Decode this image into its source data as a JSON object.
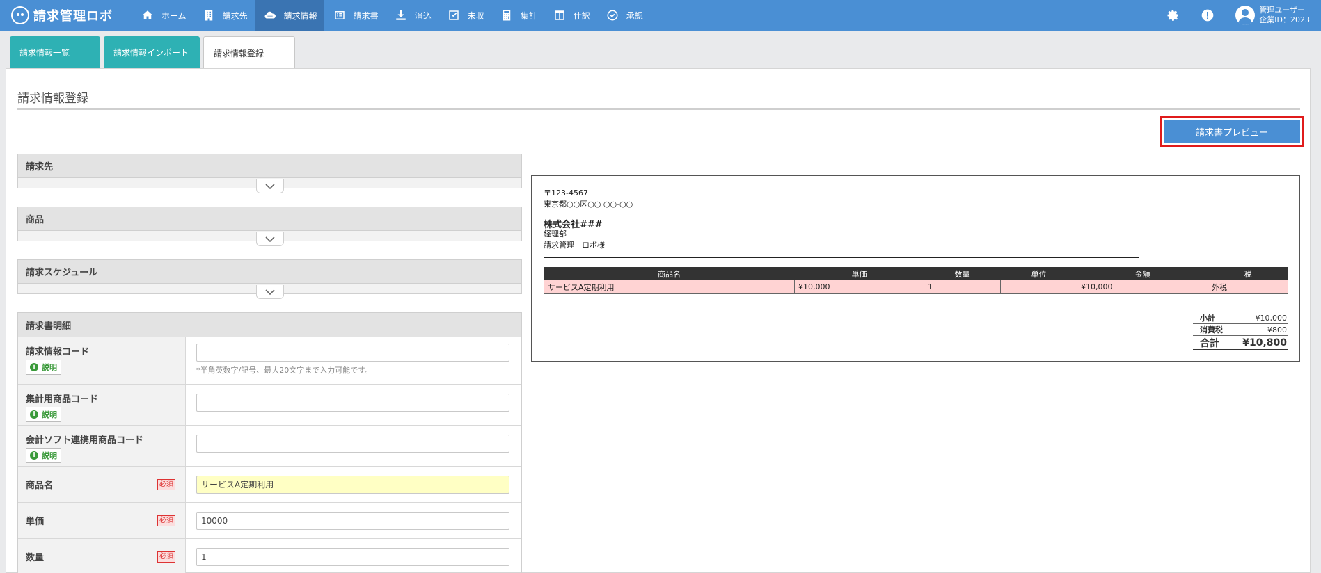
{
  "app": {
    "name": "請求管理ロボ"
  },
  "nav": {
    "items": [
      {
        "label": "ホーム",
        "icon": "home-icon"
      },
      {
        "label": "請求先",
        "icon": "building-icon"
      },
      {
        "label": "請求情報",
        "icon": "cloud-icon"
      },
      {
        "label": "請求書",
        "icon": "list-icon"
      },
      {
        "label": "消込",
        "icon": "download-icon"
      },
      {
        "label": "未収",
        "icon": "check-square-icon"
      },
      {
        "label": "集計",
        "icon": "calculator-icon"
      },
      {
        "label": "仕訳",
        "icon": "columns-icon"
      },
      {
        "label": "承認",
        "icon": "check-circle-icon"
      }
    ],
    "active_index": 2
  },
  "user": {
    "name": "管理ユーザー",
    "company_id": "企業ID：2023"
  },
  "tabs": [
    {
      "label": "請求情報一覧"
    },
    {
      "label": "請求情報インポート"
    },
    {
      "label": "請求情報登録"
    }
  ],
  "page": {
    "title": "請求情報登録"
  },
  "sections": {
    "billing_to": "請求先",
    "product": "商品",
    "schedule": "請求スケジュール",
    "detail": "請求書明細"
  },
  "form": {
    "explain_label": "説明",
    "required_label": "必須",
    "fields": {
      "billing_code": {
        "label": "請求情報コード",
        "value": "",
        "hint": "*半角英数字/記号、最大20文字まで入力可能です。"
      },
      "aggregate_code": {
        "label": "集計用商品コード",
        "value": ""
      },
      "accounting_code": {
        "label": "会計ソフト連携用商品コード",
        "value": ""
      },
      "product_name": {
        "label": "商品名",
        "value": "サービスA定期利用"
      },
      "unit_price": {
        "label": "単価",
        "value": "10000"
      },
      "quantity": {
        "label": "数量",
        "value": "1"
      }
    }
  },
  "preview": {
    "button_label": "請求書プレビュー",
    "postal": "〒123-4567",
    "address": "東京都○○区○○ ○○-○○",
    "company": "株式会社###",
    "department": "経理部",
    "recipient": "請求管理　ロボ様",
    "columns": [
      "商品名",
      "単価",
      "数量",
      "単位",
      "金額",
      "税"
    ],
    "row": {
      "name": "サービスA定期利用",
      "price": "¥10,000",
      "qty": "1",
      "unit": "",
      "amount": "¥10,000",
      "tax": "外税"
    },
    "totals": {
      "subtotal_label": "小計",
      "subtotal": "¥10,000",
      "tax_label": "消費税",
      "tax": "¥800",
      "total_label": "合計",
      "total": "¥10,800"
    }
  }
}
